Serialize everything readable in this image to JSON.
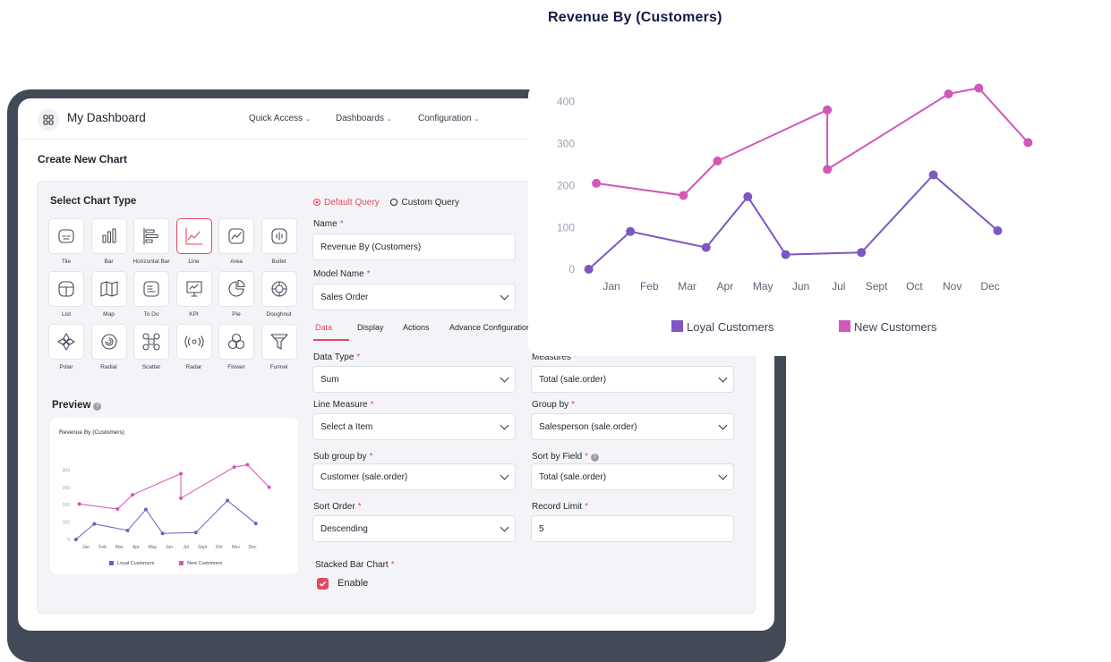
{
  "app": {
    "title": "My Dashboard",
    "nav": [
      "Quick Access",
      "Dashboards",
      "Configuration"
    ],
    "page_title": "Create New Chart"
  },
  "chart_types": {
    "title": "Select Chart Type",
    "items": [
      {
        "label": "Tile",
        "icon": "tile-icon"
      },
      {
        "label": "Bar",
        "icon": "bar-chart-icon"
      },
      {
        "label": "Horizontal Bar",
        "icon": "horizontal-bar-icon"
      },
      {
        "label": "Line",
        "icon": "line-chart-icon",
        "active": true
      },
      {
        "label": "Area",
        "icon": "area-chart-icon"
      },
      {
        "label": "Bullet",
        "icon": "bullet-chart-icon"
      },
      {
        "label": "List",
        "icon": "list-icon"
      },
      {
        "label": "Map",
        "icon": "map-icon"
      },
      {
        "label": "To Do",
        "icon": "todo-icon"
      },
      {
        "label": "KPI",
        "icon": "kpi-icon"
      },
      {
        "label": "Pie",
        "icon": "pie-chart-icon"
      },
      {
        "label": "Doughnut",
        "icon": "doughnut-icon"
      },
      {
        "label": "Polar",
        "icon": "polar-icon"
      },
      {
        "label": "Radial",
        "icon": "radial-icon"
      },
      {
        "label": "Scatter",
        "icon": "scatter-icon"
      },
      {
        "label": "Radar",
        "icon": "radar-icon"
      },
      {
        "label": "Flower",
        "icon": "flower-icon"
      },
      {
        "label": "Funnel",
        "icon": "funnel-icon"
      }
    ]
  },
  "preview": {
    "title": "Preview",
    "card_title": "Revenue By (Customers)"
  },
  "query": {
    "default_label": "Default Query",
    "custom_label": "Custom Query",
    "selected": "default"
  },
  "form": {
    "name_label": "Name",
    "name_value": "Revenue By (Customers)",
    "model_label": "Model Name",
    "model_value": "Sales Order",
    "tabs": [
      "Data",
      "Display",
      "Actions",
      "Advance Configuration"
    ],
    "active_tab": "Data",
    "data_type_label": "Data Type",
    "data_type_value": "Sum",
    "measures_label": "Measures",
    "measures_value": "Total (sale.order)",
    "line_measure_label": "Line Measure",
    "line_measure_placeholder": "Select a Item",
    "group_by_label": "Group by",
    "group_by_value": "Salesperson (sale.order)",
    "sub_group_label": "Sub group by",
    "sub_group_value": "Customer (sale.order)",
    "sort_field_label": "Sort by Field",
    "sort_field_value": "Total  (sale.order)",
    "sort_order_label": "Sort Order",
    "sort_order_value": "Descending",
    "record_limit_label": "Record Limit",
    "record_limit_value": "5",
    "stacked_label": "Stacked Bar Chart",
    "enable_label": "Enable",
    "enable_checked": true
  },
  "colors": {
    "accent": "#e34a5e",
    "loyal": "#7e57c2",
    "new": "#d058b8",
    "title_navy": "#141a44",
    "frame": "#414a56"
  },
  "chart_data": {
    "type": "line",
    "title": "Revenue By (Customers)",
    "categories": [
      "Jan",
      "Feb",
      "Mar",
      "Apr",
      "May",
      "Jun",
      "Jul",
      "Sept",
      "Oct",
      "Nov",
      "Dec"
    ],
    "yticks": [
      0,
      100,
      200,
      300,
      400
    ],
    "ylim": [
      0,
      450
    ],
    "legend_position": "bottom",
    "series": [
      {
        "name": "Loyal Customers",
        "color": "#7e57c2",
        "points": [
          [
            -0.6,
            0
          ],
          [
            0.5,
            90
          ],
          [
            2.5,
            52
          ],
          [
            3.6,
            173
          ],
          [
            4.6,
            35
          ],
          [
            6.6,
            40
          ],
          [
            8.5,
            225
          ],
          [
            10.2,
            92
          ]
        ]
      },
      {
        "name": "New Customers",
        "color": "#d058b8",
        "points": [
          [
            -0.4,
            205
          ],
          [
            1.9,
            176
          ],
          [
            2.8,
            258
          ],
          [
            5.7,
            380
          ],
          [
            5.7,
            238
          ],
          [
            8.9,
            418
          ],
          [
            9.7,
            432
          ],
          [
            11.0,
            302
          ]
        ]
      }
    ]
  }
}
